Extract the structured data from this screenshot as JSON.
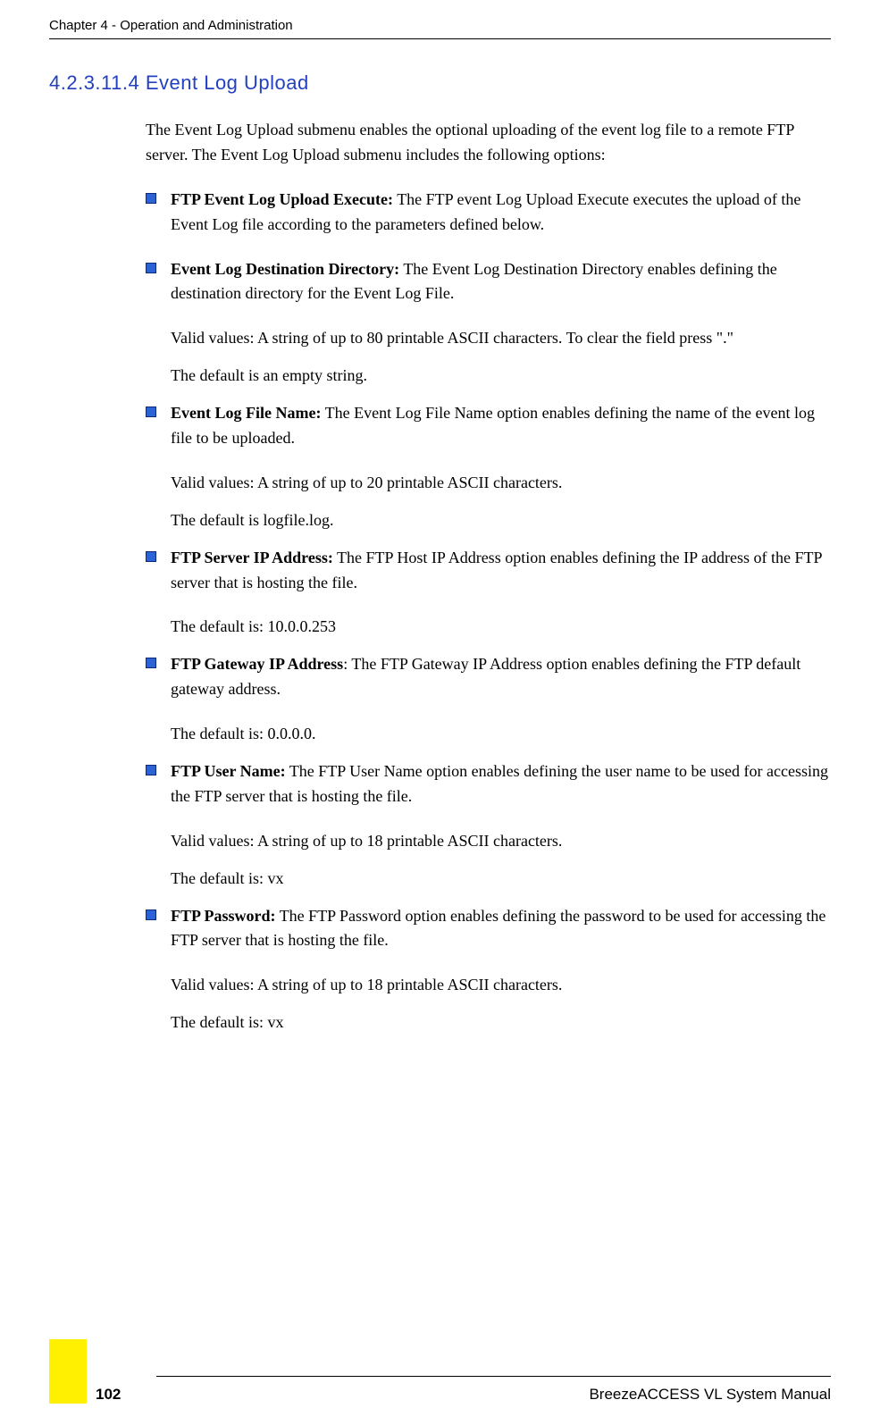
{
  "header": "Chapter 4 - Operation and Administration",
  "section_title": "4.2.3.11.4 Event Log Upload",
  "intro": "The Event Log Upload submenu enables the optional uploading of the event log file to a remote FTP server. The Event Log Upload submenu includes the following options:",
  "items": [
    {
      "label": "FTP Event Log Upload Execute:",
      "desc": " The FTP event Log Upload Execute executes the upload of the Event Log file according to the parameters defined below.",
      "subs": []
    },
    {
      "label": "Event Log Destination Directory:",
      "desc": " The Event Log Destination Directory enables defining the destination directory for the Event Log File.",
      "subs": [
        "Valid values: A string of up to 80 printable ASCII characters. To clear the field press \".\"",
        "The default is an empty string."
      ]
    },
    {
      "label": "Event Log File Name:",
      "desc": " The Event Log File Name option enables defining the name of the event log file to be uploaded.",
      "subs": [
        "Valid values: A string of up to 20 printable ASCII characters.",
        "The default is logfile.log."
      ]
    },
    {
      "label": "FTP Server IP Address:",
      "desc": " The FTP Host IP Address option enables defining the IP address of the FTP server that is hosting the file.",
      "subs": [
        "The default is: 10.0.0.253"
      ]
    },
    {
      "label": "FTP Gateway IP Address",
      "desc": ": The FTP Gateway IP Address option enables defining the FTP default gateway address.",
      "subs": [
        "The default is: 0.0.0.0."
      ]
    },
    {
      "label": "FTP User Name:",
      "desc": " The FTP User Name option enables defining the user name to be used for accessing the FTP server that is hosting the file.",
      "subs": [
        "Valid values: A string of up to 18 printable ASCII characters.",
        "The default is: vx"
      ]
    },
    {
      "label": "FTP Password:",
      "desc": " The FTP Password option enables defining the password to be used for accessing the FTP server that is hosting the file.",
      "subs": [
        "Valid values: A string of up to 18 printable ASCII characters.",
        "The default is: vx"
      ]
    }
  ],
  "footer": {
    "page": "102",
    "manual": "BreezeACCESS VL System Manual"
  }
}
